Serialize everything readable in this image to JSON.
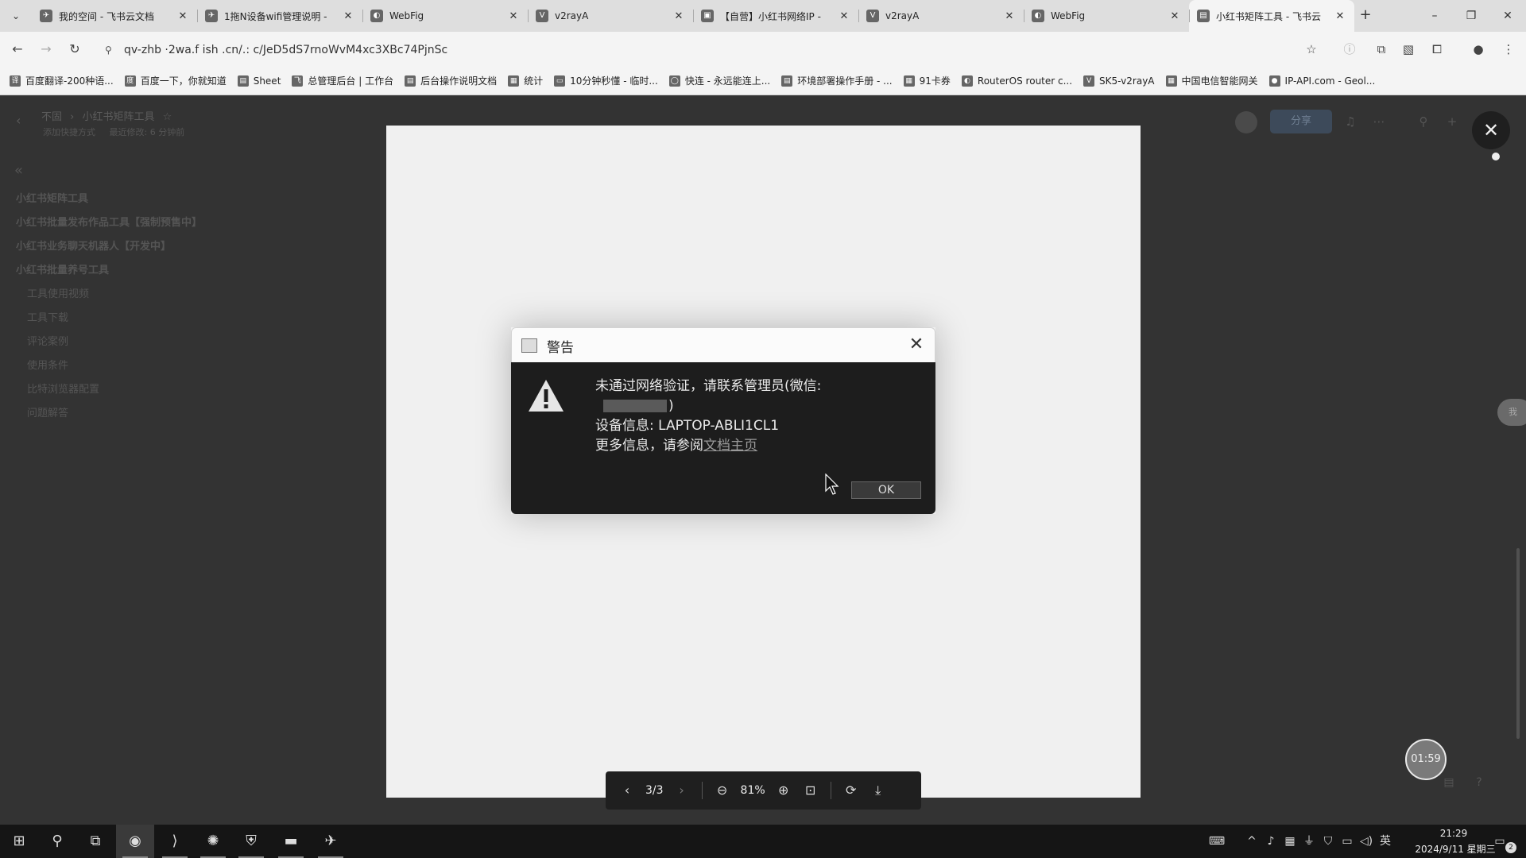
{
  "browser": {
    "tabs": [
      {
        "icon": "✈",
        "title": "我的空间 - 飞书云文档"
      },
      {
        "icon": "✈",
        "title": "1拖N设备wifi管理说明 -"
      },
      {
        "icon": "◐",
        "title": "WebFig"
      },
      {
        "icon": "V",
        "title": "v2rayA"
      },
      {
        "icon": "▣",
        "title": "【自营】小红书网络IP -"
      },
      {
        "icon": "V",
        "title": "v2rayA"
      },
      {
        "icon": "◐",
        "title": "WebFig"
      },
      {
        "icon": "▤",
        "title": "小红书矩阵工具 - 飞书云"
      }
    ],
    "tab_close_glyph": "✕",
    "new_tab_glyph": "+",
    "window": {
      "minimize": "–",
      "restore": "❐",
      "close": "✕"
    },
    "url": "qv-zhb ·2wa.f ish .cn/.: c/JeD5dS7rnoWvM4xc3XBc74PjnSc",
    "bookmarks": [
      {
        "icon": "译",
        "label": "百度翻译-200种语..."
      },
      {
        "icon": "度",
        "label": "百度一下，你就知道"
      },
      {
        "icon": "▤",
        "label": "Sheet"
      },
      {
        "icon": "飞",
        "label": "总管理后台 | 工作台"
      },
      {
        "icon": "▤",
        "label": "后台操作说明文档"
      },
      {
        "icon": "▦",
        "label": "统计"
      },
      {
        "icon": "▭",
        "label": "10分钟秒懂 - 临时..."
      },
      {
        "icon": "◯",
        "label": "快连 - 永远能连上..."
      },
      {
        "icon": "▤",
        "label": "环境部署操作手册 - ..."
      },
      {
        "icon": "▦",
        "label": "91卡券"
      },
      {
        "icon": "◐",
        "label": "RouterOS router c..."
      },
      {
        "icon": "V",
        "label": "SK5-v2rayA"
      },
      {
        "icon": "▦",
        "label": "中国电信智能网关"
      },
      {
        "icon": "●",
        "label": "IP-API.com - Geol..."
      }
    ]
  },
  "doc": {
    "breadcrumb": [
      "不固",
      "›",
      "小红书矩阵工具",
      "☆"
    ],
    "meta": [
      "添加快捷方式",
      "最近修改: 6 分钟前"
    ],
    "share_label": "分享",
    "sidebar_items": [
      {
        "label": "小红书矩阵工具",
        "level": 0
      },
      {
        "label": "小红书批量发布作品工具【强制预售中】",
        "level": 0
      },
      {
        "label": "小红书业务聊天机器人【开发中】",
        "level": 0
      },
      {
        "label": "小红书批量养号工具",
        "level": 0
      },
      {
        "label": "工具使用视频",
        "level": 1
      },
      {
        "label": "工具下载",
        "level": 1
      },
      {
        "label": "评论案例",
        "level": 1
      },
      {
        "label": "使用条件",
        "level": 1
      },
      {
        "label": "比特浏览器配置",
        "level": 1
      },
      {
        "label": "问题解答",
        "level": 1
      }
    ]
  },
  "dialog": {
    "title": "警告",
    "close_glyph": "✕",
    "message_line1": "未通过网络验证，请联系管理员(微信:",
    "message_line2_suffix": ")",
    "device_info": "设备信息: LAPTOP-ABLI1CL1",
    "more_info_prefix": "更多信息，请参阅",
    "more_info_link": "文档主页",
    "ok_label": "OK"
  },
  "viewer": {
    "close_glyph": "✕",
    "page_indicator": "3/3",
    "zoom": "81%",
    "timer": "01:59",
    "right_float_label": "我"
  },
  "taskbar": {
    "ime": "英",
    "time": "21:29",
    "date": "2024/9/11 星期三",
    "notification_count": "2"
  },
  "colors": {
    "dialog_body": "#1d1d1d",
    "viewer_toolbar": "#1f1f1f",
    "taskbar": "#151515"
  }
}
